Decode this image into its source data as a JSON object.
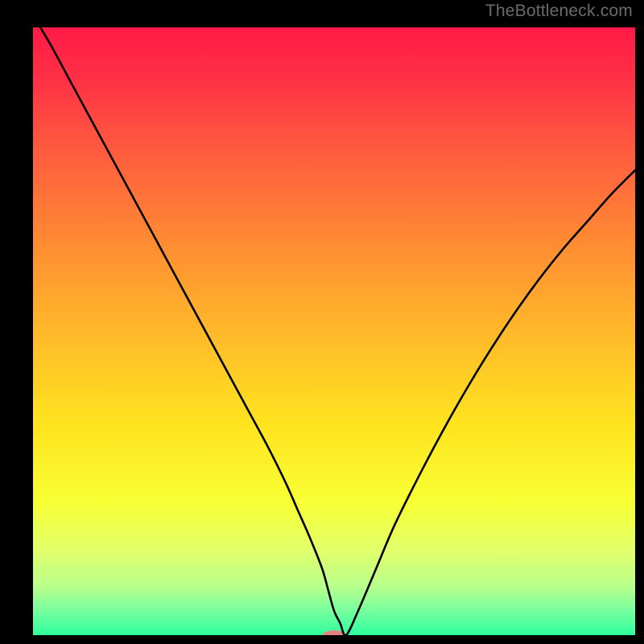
{
  "watermark": "TheBottleneck.com",
  "chart_data": {
    "type": "line",
    "title": "",
    "xlabel": "",
    "ylabel": "",
    "xlim": [
      0,
      100
    ],
    "ylim": [
      0,
      100
    ],
    "gradient_stops": [
      {
        "offset": 0.0,
        "color": "#ff1a46"
      },
      {
        "offset": 0.08,
        "color": "#ff2f46"
      },
      {
        "offset": 0.2,
        "color": "#ff5a3f"
      },
      {
        "offset": 0.35,
        "color": "#ff8a33"
      },
      {
        "offset": 0.5,
        "color": "#ffb82a"
      },
      {
        "offset": 0.65,
        "color": "#ffe31f"
      },
      {
        "offset": 0.78,
        "color": "#f8ff33"
      },
      {
        "offset": 0.86,
        "color": "#e2ff6a"
      },
      {
        "offset": 0.92,
        "color": "#b8ff8c"
      },
      {
        "offset": 0.96,
        "color": "#77ff9e"
      },
      {
        "offset": 1.0,
        "color": "#2fff9e"
      }
    ],
    "series": [
      {
        "name": "bottleneck-curve",
        "x": [
          0,
          3,
          6,
          9,
          12,
          15,
          18,
          21,
          24,
          27,
          30,
          33,
          36,
          39,
          42,
          44,
          46,
          48,
          49,
          50,
          51,
          52,
          54,
          57,
          60,
          64,
          68,
          72,
          76,
          80,
          84,
          88,
          92,
          96,
          100
        ],
        "values": [
          102,
          97,
          91.5,
          86,
          80.5,
          75,
          69.5,
          64,
          58.5,
          53,
          47.5,
          42,
          36.5,
          31,
          25,
          20.5,
          16,
          11,
          7.5,
          4,
          2,
          0,
          4,
          11,
          18,
          26,
          33.5,
          40.5,
          47,
          53,
          58.5,
          63.5,
          68,
          72.5,
          76.5
        ]
      }
    ],
    "marker": {
      "name": "min-marker",
      "x": 50,
      "y": 0,
      "color": "#e98080",
      "rx": 14,
      "ry": 6
    }
  }
}
